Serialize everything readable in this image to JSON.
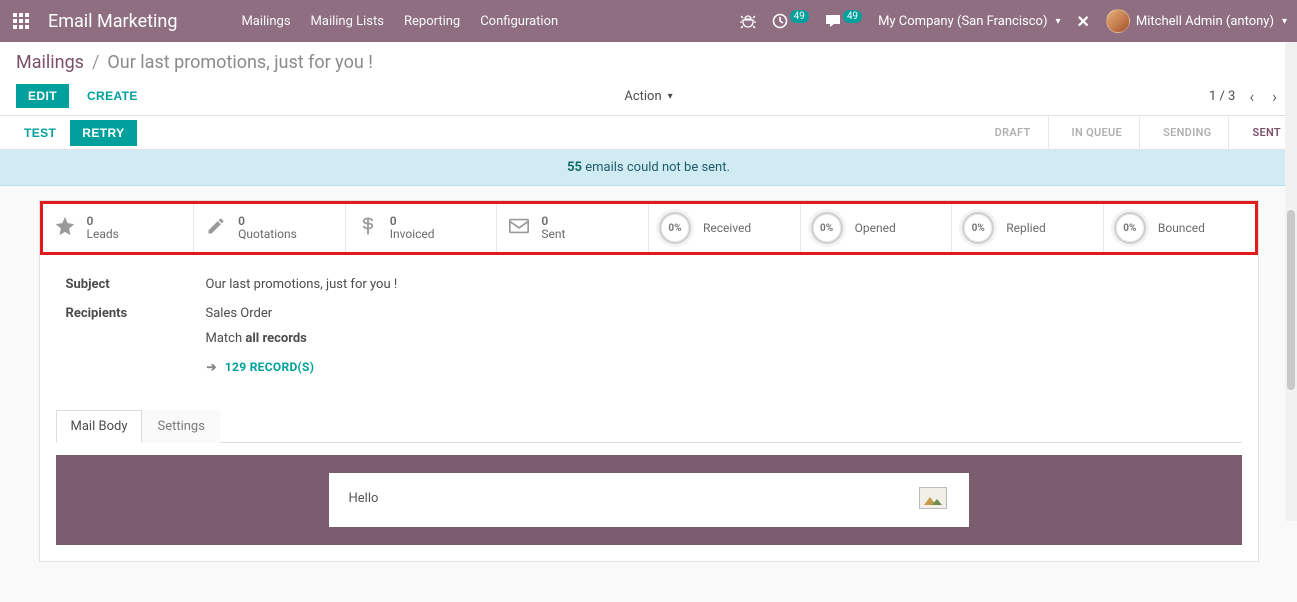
{
  "nav": {
    "brand": "Email Marketing",
    "menu": [
      "Mailings",
      "Mailing Lists",
      "Reporting",
      "Configuration"
    ],
    "debug_icon": "bug",
    "activities_badge": "49",
    "messages_badge": "49",
    "company": "My Company (San Francisco)",
    "user": "Mitchell Admin (antony)"
  },
  "breadcrumb": {
    "root": "Mailings",
    "current": "Our last promotions, just for you !"
  },
  "buttons": {
    "edit": "EDIT",
    "create": "CREATE",
    "action": "Action",
    "test": "TEST",
    "retry": "RETRY"
  },
  "pager": {
    "text": "1 / 3"
  },
  "stages": {
    "items": [
      "DRAFT",
      "IN QUEUE",
      "SENDING",
      "SENT"
    ],
    "active_index": 3
  },
  "alert": {
    "count": "55",
    "text": " emails could not be sent."
  },
  "stats": {
    "counts": [
      {
        "icon": "star",
        "value": "0",
        "label": "Leads"
      },
      {
        "icon": "pencil",
        "value": "0",
        "label": "Quotations"
      },
      {
        "icon": "dollar",
        "value": "0",
        "label": "Invoiced"
      },
      {
        "icon": "envelope",
        "value": "0",
        "label": "Sent"
      }
    ],
    "percents": [
      {
        "value": "0%",
        "label": "Received"
      },
      {
        "value": "0%",
        "label": "Opened"
      },
      {
        "value": "0%",
        "label": "Replied"
      },
      {
        "value": "0%",
        "label": "Bounced"
      }
    ]
  },
  "form": {
    "subject_label": "Subject",
    "subject_value": "Our last promotions, just for you !",
    "recipients_label": "Recipients",
    "recipients_value": "Sales Order",
    "match_prefix": "Match ",
    "match_bold": "all records",
    "records_link": "129 RECORD(S)"
  },
  "tabs": {
    "items": [
      "Mail Body",
      "Settings"
    ],
    "active_index": 0
  },
  "mailbody": {
    "greeting": "Hello"
  }
}
